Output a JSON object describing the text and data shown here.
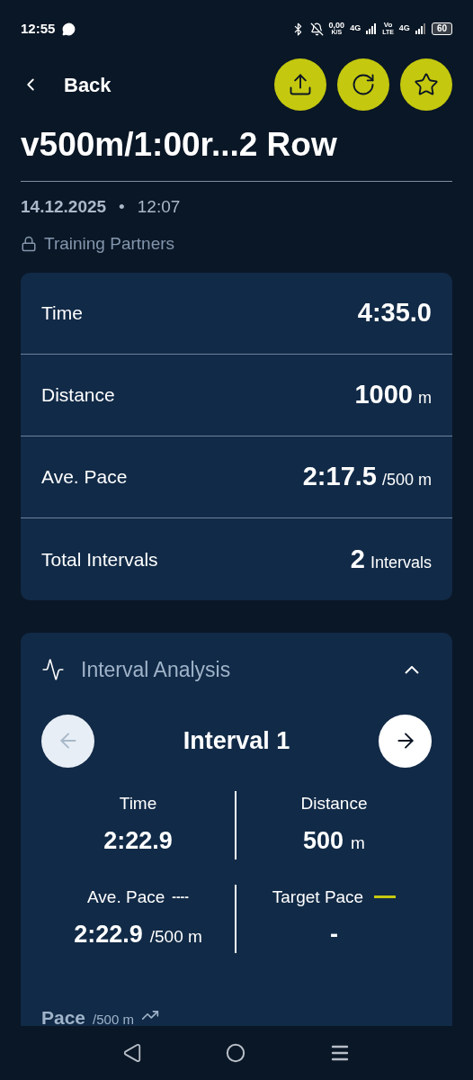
{
  "status_bar": {
    "time": "12:55",
    "speed": "0,00",
    "speed_unit": "K/S",
    "network_1": "4G",
    "volte_top": "Vo",
    "volte_bottom": "LTE",
    "network_2": "4G",
    "battery": "60"
  },
  "header": {
    "back_label": "Back",
    "actions": [
      {
        "kind": "share"
      },
      {
        "kind": "sync"
      },
      {
        "kind": "favorite"
      }
    ]
  },
  "title": "v500m/1:00r...2 Row",
  "date": "14.12.2025",
  "separator": "•",
  "time": "12:07",
  "visibility": "Training Partners",
  "summary": [
    {
      "label": "Time",
      "value": "4:35.0"
    },
    {
      "label": "Distance",
      "value": "1000",
      "unit": "m"
    },
    {
      "label": "Ave. Pace",
      "value": "2:17.5",
      "unit": "/500 m"
    },
    {
      "label": "Total Intervals",
      "value": "2",
      "unit": "Intervals"
    }
  ],
  "interval_analysis": {
    "title": "Interval Analysis",
    "expanded": true,
    "interval_label": "Interval 1",
    "prev_disabled": true,
    "next_disabled": false,
    "stats": [
      {
        "label": "Time",
        "value": "2:22.9"
      },
      {
        "label": "Distance",
        "value": "500",
        "unit": "m"
      },
      {
        "label": "Ave. Pace",
        "legend": "----",
        "value": "2:22.9",
        "unit": "/500 m"
      },
      {
        "label": "Target Pace",
        "target_line": true,
        "value": "-"
      }
    ],
    "chart_heading": "Pace",
    "chart_unit": "/500 m"
  },
  "nav_bar": [
    {
      "kind": "back"
    },
    {
      "kind": "home"
    },
    {
      "kind": "recents"
    }
  ]
}
